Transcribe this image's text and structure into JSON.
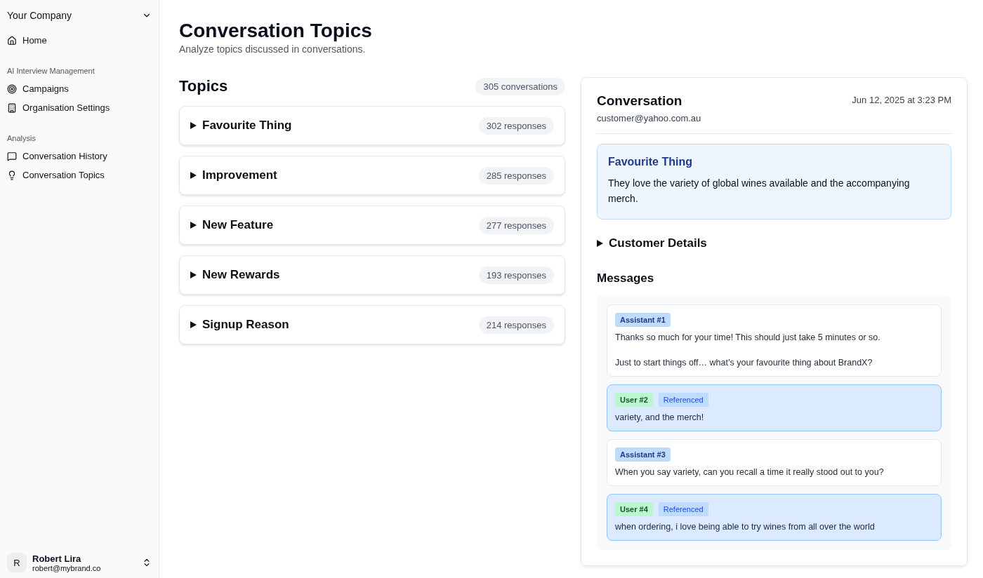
{
  "sidebar": {
    "company": "Your Company",
    "sections": [
      {
        "items": [
          {
            "label": "Home",
            "kind": "home"
          }
        ]
      },
      {
        "heading": "AI Interview Management",
        "items": [
          {
            "label": "Campaigns",
            "kind": "campaigns"
          },
          {
            "label": "Organisation Settings",
            "kind": "settings"
          }
        ]
      },
      {
        "heading": "Analysis",
        "items": [
          {
            "label": "Conversation History",
            "kind": "history"
          },
          {
            "label": "Conversation Topics",
            "kind": "topics"
          }
        ]
      }
    ],
    "user": {
      "initial": "R",
      "name": "Robert Lira",
      "email": "robert@mybrand.co"
    }
  },
  "page": {
    "title": "Conversation Topics",
    "subtitle": "Analyze topics discussed in conversations."
  },
  "topics": {
    "title": "Topics",
    "count": "305 conversations",
    "items": [
      {
        "label": "Favourite Thing",
        "count": "302 responses",
        "expanded": false
      },
      {
        "label": "Improvement",
        "count": "285 responses",
        "expanded": false
      },
      {
        "label": "New Feature",
        "count": "277 responses",
        "expanded": false
      },
      {
        "label": "New Rewards",
        "count": "193 responses",
        "expanded": false
      },
      {
        "label": "Signup Reason",
        "count": "214 responses",
        "expanded": false
      }
    ]
  },
  "conversation": {
    "title": "Conversation",
    "date": "Jun 12, 2025 at 3:23 PM",
    "email": "customer@yahoo.com.au",
    "summary": {
      "title": "Favourite Thing",
      "text": "They love the variety of global wines available and the accompanying merch."
    },
    "details": {
      "label": "Customer Details",
      "expanded": false
    },
    "messages_title": "Messages",
    "messages": [
      {
        "kind": "assistant",
        "role": "Assistant #1",
        "highlighted": false,
        "text": "Thanks so much for your time! This should just take 5 minutes or so.\n\nJust to start things off… what’s your favourite thing about BrandX?"
      },
      {
        "kind": "user",
        "role": "User #2",
        "tag": "Referenced",
        "highlighted": true,
        "text": "variety, and the merch!"
      },
      {
        "kind": "assistant",
        "role": "Assistant #3",
        "highlighted": false,
        "text": "When you say variety, can you recall a time it really stood out to you?"
      },
      {
        "kind": "user",
        "role": "User #4",
        "tag": "Referenced",
        "highlighted": true,
        "text": "when ordering, i love being able to try wines from all over the world"
      }
    ]
  }
}
